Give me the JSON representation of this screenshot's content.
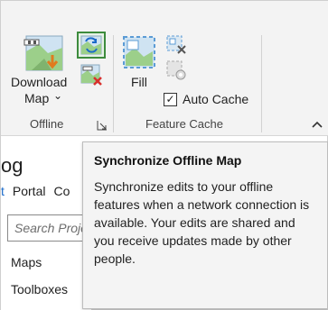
{
  "ribbon": {
    "download_map": {
      "line1": "Download",
      "line2": "Map",
      "dropdown_glyph": "⌄"
    },
    "fill": {
      "label": "Fill"
    },
    "auto_cache": {
      "label": "Auto Cache",
      "checked": true,
      "check_glyph": "✓"
    },
    "groups": {
      "offline": "Offline",
      "feature_cache": "Feature Cache"
    },
    "icons": {
      "download_map": "download-map-icon",
      "sync": "synchronize-offline-map-icon",
      "remove": "remove-offline-map-icon",
      "fill": "fill-cache-icon",
      "cache_a": "clear-cache-icon",
      "cache_b": "cache-settings-icon",
      "launcher": "dialog-launcher-icon",
      "collapse": "collapse-ribbon-icon"
    },
    "accent_color": "#3d8b3d"
  },
  "pane": {
    "title": "og",
    "tabs": [
      "t",
      "Portal",
      "Co"
    ],
    "search_placeholder": "Search Proje",
    "items": [
      "Maps",
      "Toolboxes"
    ],
    "tab_accent": "#1b6ac9"
  },
  "tooltip": {
    "title": "Synchronize Offline Map",
    "body": "Synchronize edits to your offline features when a network connection is available. Your edits are shared and you receive updates made by other people."
  }
}
